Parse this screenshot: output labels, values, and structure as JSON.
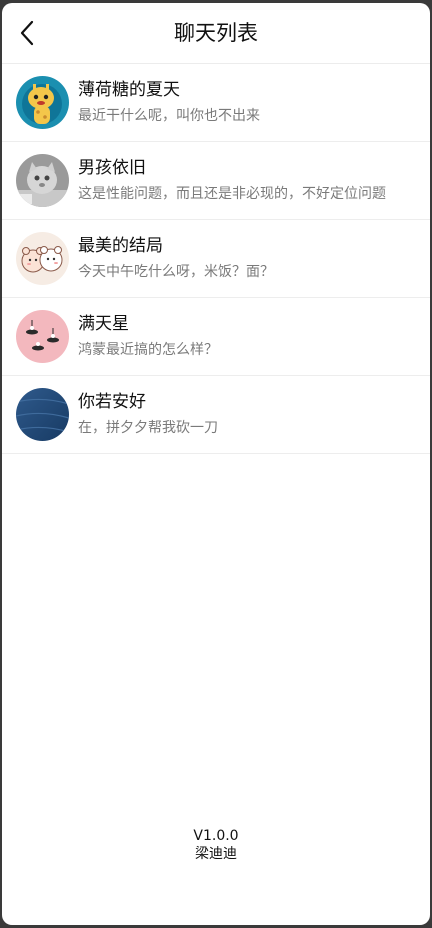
{
  "header": {
    "title": "聊天列表",
    "back_icon": "chevron-left-icon"
  },
  "contacts": [
    {
      "name": "薄荷糖的夏天",
      "message": "最近干什么呢，叫你也不出来",
      "avatar": "cartoon-giraffe-avatar"
    },
    {
      "name": "男孩依旧",
      "message": "这是性能问题，而且还是非必现的，不好定位问题",
      "avatar": "cat-photo-avatar"
    },
    {
      "name": "最美的结局",
      "message": "今天中午吃什么呀，米饭？面？",
      "avatar": "cartoon-bears-avatar"
    },
    {
      "name": "满天星",
      "message": "鸿蒙最近搞的怎么样？",
      "avatar": "pink-pattern-avatar"
    },
    {
      "name": "你若安好",
      "message": "在，拼夕夕帮我砍一刀",
      "avatar": "blue-fabric-avatar"
    }
  ],
  "footer": {
    "version": "V1.0.0",
    "author": "梁迪迪"
  }
}
